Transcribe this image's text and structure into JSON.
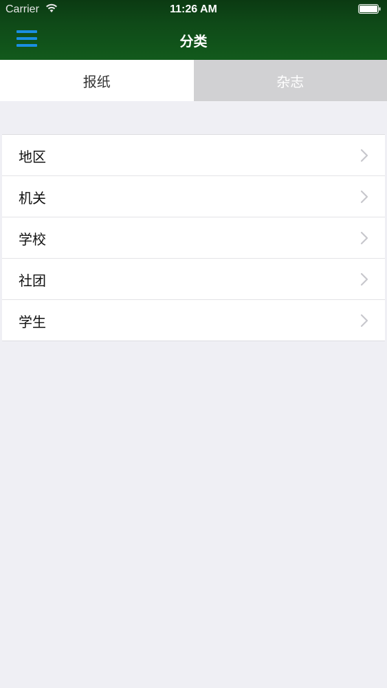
{
  "status_bar": {
    "carrier": "Carrier",
    "time": "11:26 AM"
  },
  "nav": {
    "title": "分类",
    "menu_icon": "hamburger-menu-icon",
    "accent_color": "#1a8fe3"
  },
  "tabs": [
    {
      "label": "报纸",
      "selected": true
    },
    {
      "label": "杂志",
      "selected": false
    }
  ],
  "categories": [
    {
      "label": "地区"
    },
    {
      "label": "机关"
    },
    {
      "label": "学校"
    },
    {
      "label": "社团"
    },
    {
      "label": "学生"
    }
  ],
  "colors": {
    "header_green": "#0f4a18",
    "background": "#efeff4",
    "tab_inactive": "#d1d1d3"
  }
}
